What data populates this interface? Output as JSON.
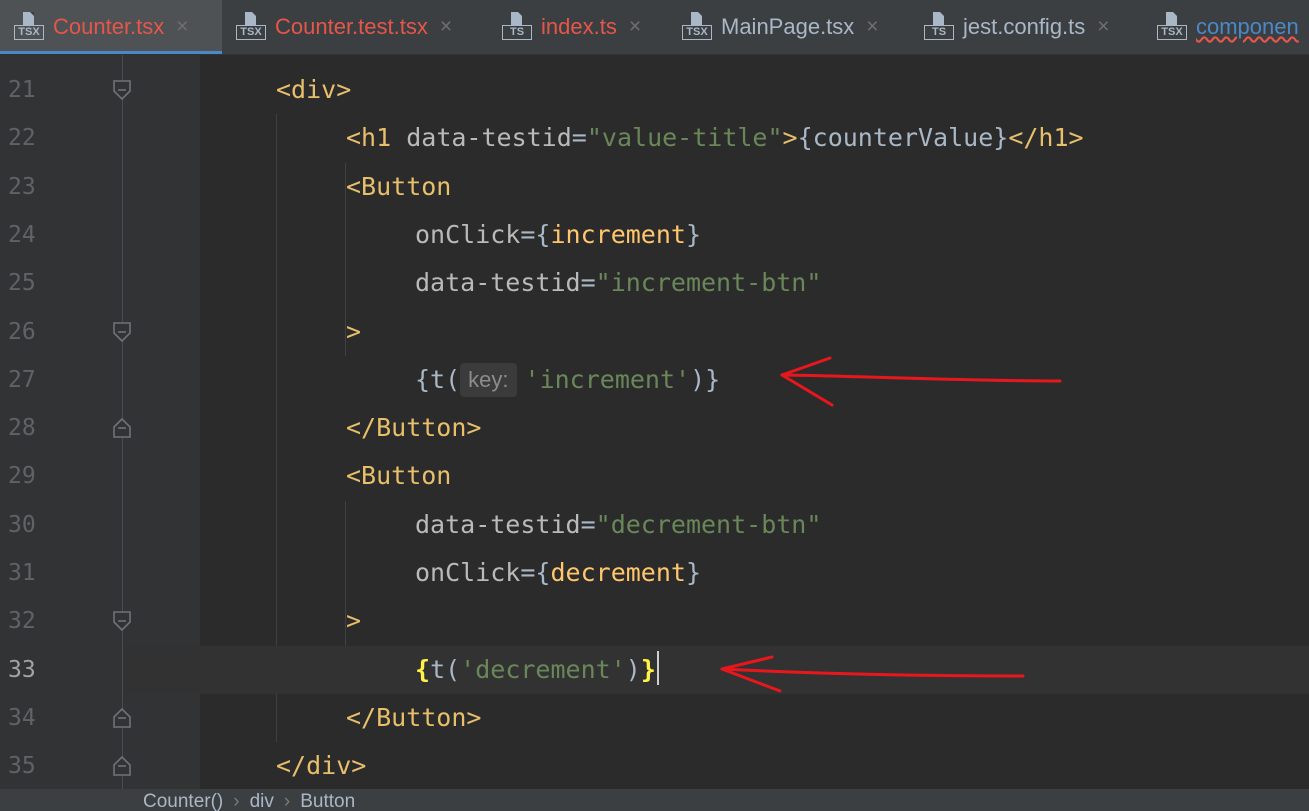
{
  "tabs": [
    {
      "name": "Counter.tsx",
      "type": "TSX",
      "active": true,
      "state": "err",
      "closable": true
    },
    {
      "name": "Counter.test.tsx",
      "type": "TSX",
      "active": false,
      "state": "err",
      "closable": true
    },
    {
      "name": "index.ts",
      "type": "TS",
      "active": false,
      "state": "err",
      "closable": true
    },
    {
      "name": "MainPage.tsx",
      "type": "TSX",
      "active": false,
      "state": "normal",
      "closable": true
    },
    {
      "name": "jest.config.ts",
      "type": "TS",
      "active": false,
      "state": "normal",
      "closable": true
    },
    {
      "name": "componen",
      "type": "TSX",
      "active": false,
      "state": "trunc",
      "closable": false
    }
  ],
  "editor": {
    "current_line": 33,
    "lines": [
      {
        "n": 21,
        "parts": [
          [
            "tag",
            "<div>"
          ]
        ]
      },
      {
        "n": 22,
        "parts": [
          [
            "tag",
            "<h1 "
          ],
          [
            "attr",
            "data-testid"
          ],
          [
            "op",
            "="
          ],
          [
            "str",
            "\"value-title\""
          ],
          [
            "tag",
            ">"
          ],
          [
            "br",
            "{counterValue}"
          ],
          [
            "tag",
            "</h1>"
          ]
        ]
      },
      {
        "n": 23,
        "parts": [
          [
            "tag",
            "<Button"
          ]
        ]
      },
      {
        "n": 24,
        "parts": [
          [
            "attr",
            "onClick"
          ],
          [
            "op",
            "="
          ],
          [
            "br",
            "{"
          ],
          [
            "fn",
            "increment"
          ],
          [
            "br",
            "}"
          ]
        ]
      },
      {
        "n": 25,
        "parts": [
          [
            "attr",
            "data-testid"
          ],
          [
            "op",
            "="
          ],
          [
            "str",
            "\"increment-btn\""
          ]
        ]
      },
      {
        "n": 26,
        "parts": [
          [
            "tag",
            ">"
          ]
        ]
      },
      {
        "n": 27,
        "parts": [
          [
            "br",
            "{t("
          ],
          [
            "hint",
            "key:"
          ],
          [
            "str",
            "'increment'"
          ],
          [
            "br",
            ")}"
          ]
        ]
      },
      {
        "n": 28,
        "parts": [
          [
            "tag",
            "</Button>"
          ]
        ]
      },
      {
        "n": 29,
        "parts": [
          [
            "tag",
            "<Button"
          ]
        ]
      },
      {
        "n": 30,
        "parts": [
          [
            "attr",
            "data-testid"
          ],
          [
            "op",
            "="
          ],
          [
            "str",
            "\"decrement-btn\""
          ]
        ]
      },
      {
        "n": 31,
        "parts": [
          [
            "attr",
            "onClick"
          ],
          [
            "op",
            "="
          ],
          [
            "br",
            "{"
          ],
          [
            "fn",
            "decrement"
          ],
          [
            "br",
            "}"
          ]
        ]
      },
      {
        "n": 32,
        "parts": [
          [
            "tag",
            ">"
          ]
        ]
      },
      {
        "n": 33,
        "parts": [
          [
            "brh",
            "{"
          ],
          [
            "br",
            "t("
          ],
          [
            "str",
            "'decrement'"
          ],
          [
            "br",
            ")"
          ],
          [
            "brh",
            "}"
          ]
        ]
      },
      {
        "n": 34,
        "parts": [
          [
            "tag",
            "</Button>"
          ]
        ]
      },
      {
        "n": 35,
        "parts": [
          [
            "tag",
            "</div>"
          ]
        ]
      }
    ]
  },
  "breadcrumb": [
    "Counter()",
    "div",
    "Button"
  ],
  "annotation_color": "#e8171d",
  "colors": {
    "background": "#2b2b2b",
    "gutter": "#313335",
    "tag": "#e8bf6a",
    "string": "#6a8759",
    "function": "#ffc66d",
    "active_tab_underline": "#4a88c7"
  }
}
